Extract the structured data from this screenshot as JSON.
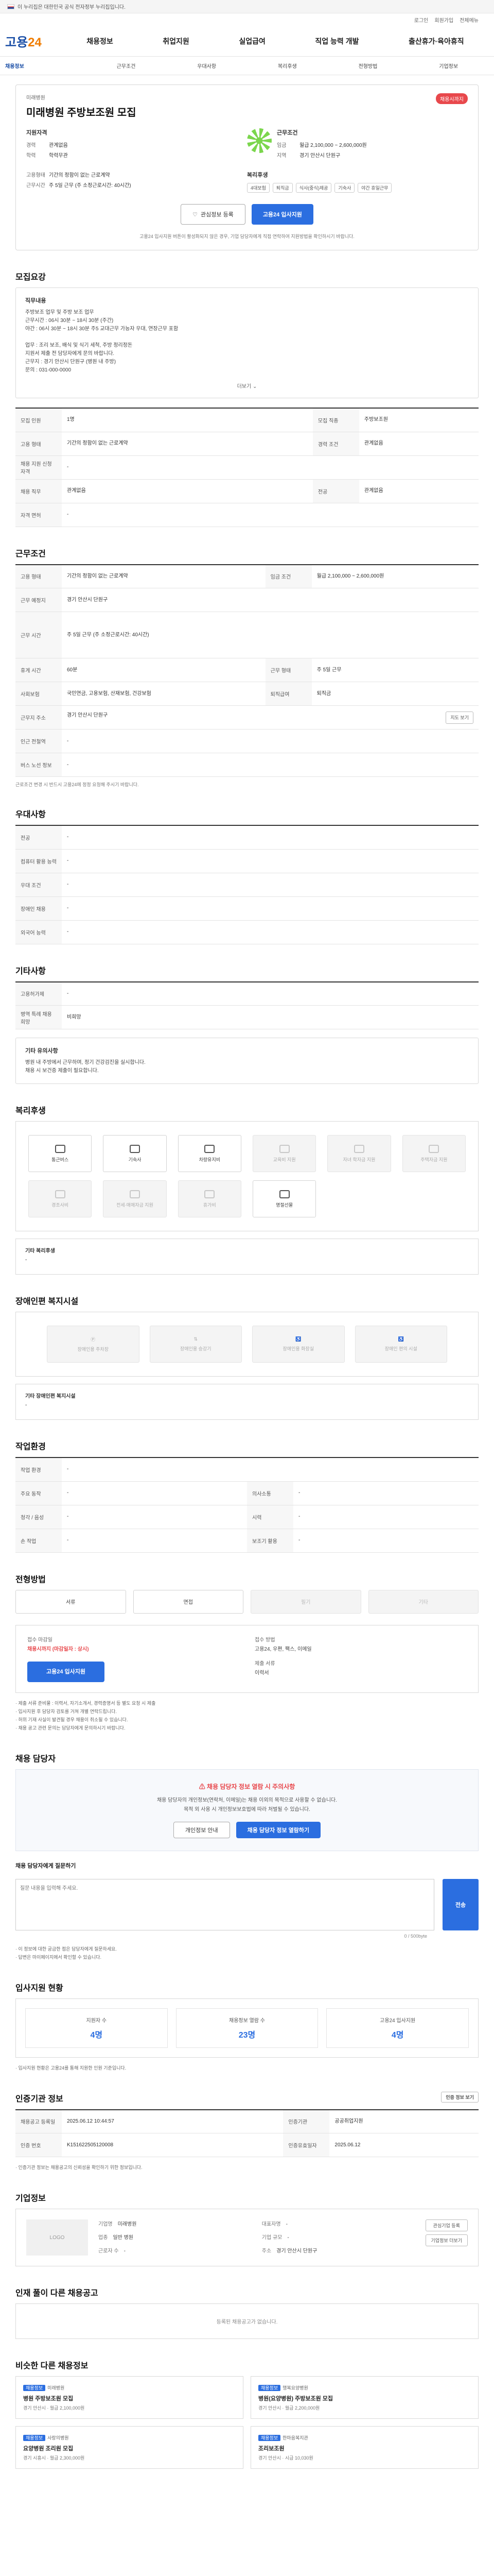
{
  "gov": {
    "text": "이 누리집은 대한민국 공식 전자정부 누리집입니다."
  },
  "util": [
    "로그인",
    "회원가입",
    "전체메뉴"
  ],
  "logo": {
    "main": "고용",
    "accent": "24"
  },
  "gnb": [
    "채용정보",
    "취업지원",
    "실업급여",
    "직업 능력 개발",
    "출산휴가·육아휴직"
  ],
  "submenu": [
    "채용정보",
    "근무조건",
    "우대사항",
    "복리후생",
    "전형방법",
    "기업정보"
  ],
  "job": {
    "company": "미래병원",
    "title": "미래병원 주방보조원 모집",
    "badge": "채용시까지",
    "qual_label": "지원자격",
    "career_k": "경력",
    "career_v": "관계없음",
    "edu_k": "학력",
    "edu_v": "학력무관",
    "cond_label": "근무조건",
    "pay_k": "임금",
    "pay_v": "월급 2,100,000 ~ 2,600,000원",
    "loc_k": "지역",
    "loc_v": "경기 안산시 단원구",
    "type_k": "고용형태",
    "type_v": "기간의 정함이 없는 근로계약",
    "hours_k": "근무시간",
    "hours_v": "주 5일 근무 (주 소정근로시간: 40시간)",
    "welfare_label": "복리후생",
    "chips": [
      "4대보험",
      "퇴직금",
      "식사(중식)제공",
      "기숙사",
      "야간 휴일근무"
    ],
    "fav": "관심정보 등록",
    "apply": "고용24 입사지원",
    "note": "고용24 입사지원 버튼이 활성화되지 않은 경우, 기업 담당자에게 직접 연락하여 지원방법을 확인하시기 바랍니다."
  },
  "recruit": {
    "heading": "모집요강",
    "box_title": "직무내용",
    "body": "주방보조 업무 및 주방 보조 업무\n근무시간 : 06시 30분 ~ 18시 30분 (주간)\n야간 : 06시 30분 ~ 18시 30분 주5 교대근무 가능자 우대, 연장근무 포함\n\n업무 : 조리 보조, 배식 및 식기 세척, 주방 정리정돈\n지원서 제출 전 담당자에게 문의 바랍니다.\n근무지 : 경기 안산시 단원구 (병원 내 주방)\n문의 : 031-000-0000",
    "more": "더보기",
    "rows": [
      {
        "k1": "모집 인원",
        "v1": "1명",
        "k2": "모집 직종",
        "v2": "주방보조원"
      },
      {
        "k1": "고용 형태",
        "v1": "기간의 정함이 없는 근로계약",
        "k2": "경력 조건",
        "v2": "관계없음"
      },
      {
        "k1": "채용 지원 신청 자격",
        "v1": "-",
        "k2": "",
        "v2": ""
      },
      {
        "k1": "채용 직무",
        "v1": "관계없음",
        "k2": "전공",
        "v2": "관계없음"
      },
      {
        "k1": "자격 면허",
        "v1": "-",
        "k2": "",
        "v2": ""
      }
    ]
  },
  "cond": {
    "heading": "근무조건",
    "rows": [
      {
        "k": "고용 형태",
        "v": "기간의 정함이 없는 근로계약",
        "k2": "임금 조건",
        "v2": "월급 2,100,000 ~ 2,600,000원"
      },
      {
        "k": "근무 예정지",
        "v": "경기 안산시 단원구",
        "k2": "",
        "v2": ""
      },
      {
        "k": "근무 시간",
        "v": "주 5일 근무 (주 소정근로시간: 40시간)",
        "k2": "",
        "v2": ""
      },
      {
        "k": "휴게 시간",
        "v": "60분",
        "k2": "근무 형태",
        "v2": "주 5일 근무"
      },
      {
        "k": "사회보험",
        "v": "국민연금, 고용보험, 산재보험, 건강보험",
        "k2": "퇴직급여",
        "v2": "퇴직금"
      },
      {
        "k": "근무지 주소",
        "v": "경기 안산시 단원구",
        "k2": "",
        "v2": ""
      },
      {
        "k": "인근 전철역",
        "v": "-",
        "k2": "",
        "v2": ""
      },
      {
        "k": "버스 노선 정보",
        "v": "-",
        "k2": "",
        "v2": ""
      }
    ],
    "map_btn": "지도 보기",
    "note": "근로조건 변경 시 반드시 고용24에 정정 요청해 주시기 바랍니다."
  },
  "pref": {
    "heading": "우대사항",
    "rows": [
      {
        "k": "전공",
        "v": "-"
      },
      {
        "k": "컴퓨터 활용 능력",
        "v": "-"
      },
      {
        "k": "우대 조건",
        "v": "-"
      },
      {
        "k": "장애인 채용",
        "v": "-"
      },
      {
        "k": "외국어 능력",
        "v": "-"
      }
    ]
  },
  "other": {
    "heading": "기타사항",
    "rows": [
      {
        "k": "고용허가제",
        "v": "-"
      },
      {
        "k": "병역 특례 채용 희망",
        "v": "비희망"
      }
    ],
    "box_title": "기타 유의사항",
    "box_body": "병원 내 주방에서 근무하며, 정기 건강검진을 실시합니다.\n채용 시 보건증 제출이 필요합니다."
  },
  "welfare": {
    "heading": "복리후생",
    "items": [
      {
        "label": "통근버스",
        "on": true
      },
      {
        "label": "기숙사",
        "on": true
      },
      {
        "label": "차량유지비",
        "on": true
      },
      {
        "label": "교육비 지원",
        "on": false
      },
      {
        "label": "자녀 학자금 지원",
        "on": false
      },
      {
        "label": "주택자금 지원",
        "on": false
      },
      {
        "label": "경조사비",
        "on": false
      },
      {
        "label": "전세·매매자금 지원",
        "on": false
      },
      {
        "label": "휴가비",
        "on": false
      },
      {
        "label": "명절선물",
        "on": true
      }
    ],
    "etc_title": "기타 복리후생",
    "etc_value": "-"
  },
  "facility": {
    "heading": "장애인편 복지시설",
    "items": [
      "장애인용 주차장",
      "장애인용 승강기",
      "장애인용 화장실",
      "장애인 편의 시설"
    ],
    "etc_title": "기타 장애인편 복지시설",
    "etc_value": "-"
  },
  "env": {
    "heading": "작업환경",
    "rows": [
      {
        "k": "작업 환경",
        "v": "-",
        "k2": "",
        "v2": ""
      },
      {
        "k": "주요 동작",
        "v": "-",
        "k2": "의사소통",
        "v2": "-"
      },
      {
        "k": "청각 / 음성",
        "v": "-",
        "k2": "시력",
        "v2": "-"
      },
      {
        "k": "손 작업",
        "v": "-",
        "k2": "보조기 활용",
        "v2": "-"
      }
    ]
  },
  "method": {
    "heading": "전형방법",
    "methods": [
      {
        "label": "서류",
        "on": true
      },
      {
        "label": "면접",
        "on": true
      },
      {
        "label": "필기",
        "on": false
      },
      {
        "label": "기타",
        "on": false
      }
    ],
    "deadline_k": "접수 마감일",
    "deadline_v": "채용시까지 (마감일자 : 상시)",
    "howto_k": "접수 방법",
    "howto_v": "고용24, 우편, 팩스, 이메일",
    "docs_k": "제출 서류",
    "docs_v": "이력서",
    "apply": "고용24 입사지원",
    "bullets": [
      "· 제출 서류 준비물 : 이력서, 자기소개서, 경력증명서 등 별도 요청 시 제출",
      "· 입사지원 후 담당자 검토를 거쳐 개별 연락드립니다.",
      "· 허위 기재 사실이 발견될 경우 채용이 취소될 수 있습니다.",
      "· 채용 공고 관련 문의는 담당자에게 문의하시기 바랍니다."
    ]
  },
  "manager": {
    "heading": "채용 담당자",
    "warn": "채용 담당자 정보 열람 시 주의사항",
    "desc1": "채용 담당자의 개인정보(연락처, 이메일)는 채용 이외의 목적으로 사용할 수 없습니다.",
    "desc2": "목적 외 사용 시 개인정보보호법에 따라 처벌될 수 있습니다.",
    "btn1": "개인정보 안내",
    "btn2": "채용 담당자 정보 열람하기",
    "q_label": "채용 담당자에게 질문하기",
    "q_placeholder": "질문 내용을 입력해 주세요.",
    "send": "전송",
    "count": "0 / 500byte",
    "notes": [
      "· 이 정보에 대한 궁금한 점은 담당자에게 질문하세요.",
      "· 답변은 마이페이지에서 확인할 수 있습니다."
    ]
  },
  "status": {
    "heading": "입사지원 현황",
    "items": [
      {
        "label": "지원자 수",
        "value": "4명"
      },
      {
        "label": "채용정보 열람 수",
        "value": "23명"
      },
      {
        "label": "고용24 입사지원",
        "value": "4명"
      }
    ],
    "note": "· 입사지원 현황은 고용24를 통해 지원한 인원 기준입니다."
  },
  "org": {
    "heading": "인증기관 정보",
    "btn": "인증 정보 보기",
    "rows": [
      {
        "k": "채용공고 등록일",
        "v": "2025.06.12 10:44:57",
        "k2": "인증기관",
        "v2": "공공취업지원"
      },
      {
        "k": "인증 번호",
        "v": "K151622505120008",
        "k2": "인증유효일자",
        "v2": "2025.06.12"
      }
    ],
    "note": "· 인증기관 정보는 채용공고의 신뢰성을 확인하기 위한 정보입니다."
  },
  "company": {
    "heading": "기업정보",
    "logo_text": "LOGO",
    "name_k": "기업명",
    "name_v": "미래병원",
    "rep_k": "대표자명",
    "rep_v": "-",
    "type_k": "업종",
    "type_v": "일반 병원",
    "size_k": "기업 규모",
    "size_v": "-",
    "emp_k": "근로자 수",
    "emp_v": "-",
    "addr_k": "주소",
    "addr_v": "경기 안산시 단원구",
    "btn1": "관심기업 등록",
    "btn2": "기업정보 더보기"
  },
  "sameco": {
    "heading": "인재 풀이 다른 채용공고",
    "empty": "등록된 채용공고가 없습니다."
  },
  "similar": {
    "heading": "비슷한 다른 채용정보",
    "cards": [
      {
        "tag": "채용정보",
        "co": "미래병원",
        "title": "병원 주방보조원 모집",
        "sub": "경기 안산시 · 월급 2,100,000원"
      },
      {
        "tag": "채용정보",
        "co": "행복요양병원",
        "title": "병원(요양병원) 주방보조원 모집",
        "sub": "경기 안산시 · 월급 2,200,000원"
      },
      {
        "tag": "채용정보",
        "co": "사랑의병원",
        "title": "요양병원 조리원 모집",
        "sub": "경기 시흥시 · 월급 2,300,000원"
      },
      {
        "tag": "채용정보",
        "co": "한마음복지관",
        "title": "조리보조원",
        "sub": "경기 안산시 · 시급 10,030원"
      }
    ]
  }
}
